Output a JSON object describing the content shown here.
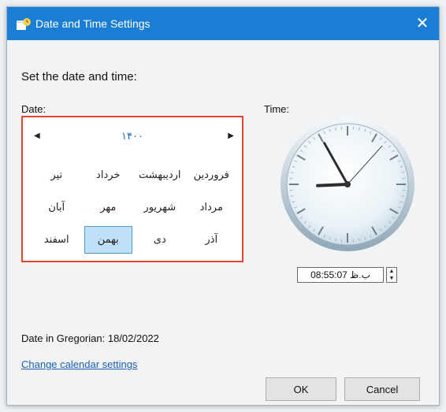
{
  "window": {
    "title": "Date and Time Settings",
    "close_glyph": "✕"
  },
  "heading": "Set the date and time:",
  "date_label": "Date:",
  "time_label": "Time:",
  "calendar": {
    "year": "۱۴۰۰",
    "prev_glyph": "◀",
    "next_glyph": "▶",
    "months": [
      "فروردین",
      "اردیبهشت",
      "خرداد",
      "تیر",
      "مرداد",
      "شهریور",
      "مهر",
      "آبان",
      "آذر",
      "دی",
      "بهمن",
      "اسفند"
    ],
    "selected_month": "بهمن",
    "highlight_color": "#e0432e"
  },
  "clock": {
    "hour": 8,
    "minute": 55,
    "second": 7
  },
  "time_field": {
    "value": "08:55:07 ب.ظ",
    "spin_up": "▲",
    "spin_down": "▼"
  },
  "gregorian_text": "Date in Gregorian: 18/02/2022",
  "change_link": "Change calendar settings",
  "buttons": {
    "ok": "OK",
    "cancel": "Cancel"
  },
  "colors": {
    "titlebar": "#1a7fd4",
    "link": "#1a5fb4"
  }
}
